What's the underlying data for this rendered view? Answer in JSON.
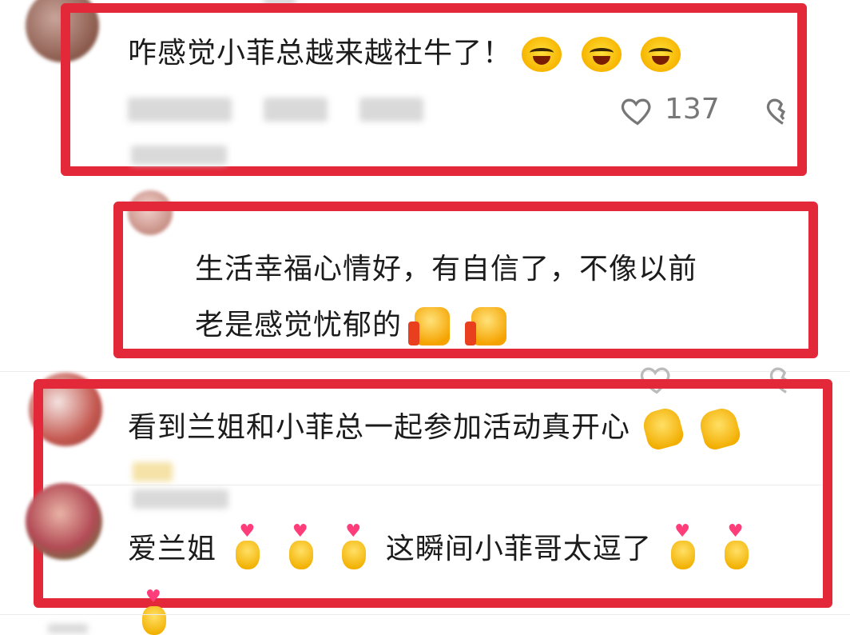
{
  "comments": [
    {
      "text": "咋感觉小菲总越来越社牛了！",
      "emojis": [
        "laughing-face",
        "laughing-face",
        "laughing-face"
      ],
      "likes": "137"
    },
    {
      "text_line1": "生活幸福心情好，有自信了，不像以前",
      "text_line2": "老是感觉忧郁的",
      "emojis": [
        "thumbs-up",
        "thumbs-up"
      ]
    },
    {
      "text": "看到兰姐和小菲总一起参加活动真开心",
      "emojis": [
        "clapping-hands",
        "clapping-hands"
      ]
    },
    {
      "text_a": "爱兰姐",
      "text_b": "这瞬间小菲哥太逗了",
      "emojis": [
        "heart-hands",
        "heart-hands",
        "heart-hands",
        "heart-hands",
        "heart-hands"
      ]
    }
  ],
  "colors": {
    "highlight": "#e3283a",
    "text": "#1b1b1b",
    "meta": "#8c8c8c"
  },
  "icons": {
    "like": "heart-outline-icon",
    "dislike": "broken-heart-icon"
  }
}
